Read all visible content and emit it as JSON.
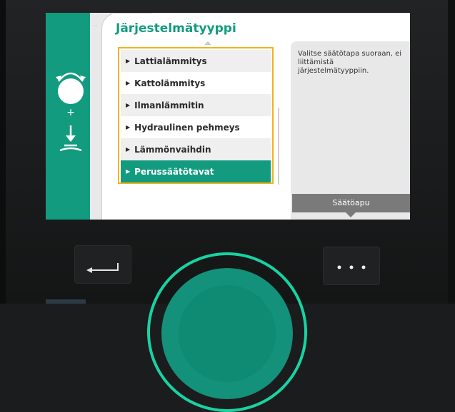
{
  "screen": {
    "title": "Järjestelmätyyppi",
    "menu_items": [
      {
        "label": "Lattialämmitys",
        "selected": false
      },
      {
        "label": "Kattolämmitys",
        "selected": false
      },
      {
        "label": "Ilmanlämmitin",
        "selected": false
      },
      {
        "label": "Hydraulinen pehmeys",
        "selected": false
      },
      {
        "label": "Lämmönvaihdin",
        "selected": false
      },
      {
        "label": "Perussäätötavat",
        "selected": true
      }
    ],
    "help_text": "Valitse säätötapa suoraan, ei liittämistä järjestelmätyyppiin.",
    "help_button": "Säätöapu",
    "left_panel_plus": "+"
  },
  "colors": {
    "accent": "#129b7f",
    "focus_border": "#f2b21c",
    "dial_ring": "#17d3a3"
  },
  "icons": [
    "rotate-knob-icon",
    "press-knob-icon",
    "back-icon",
    "more-icon",
    "triangle-right-icon"
  ]
}
